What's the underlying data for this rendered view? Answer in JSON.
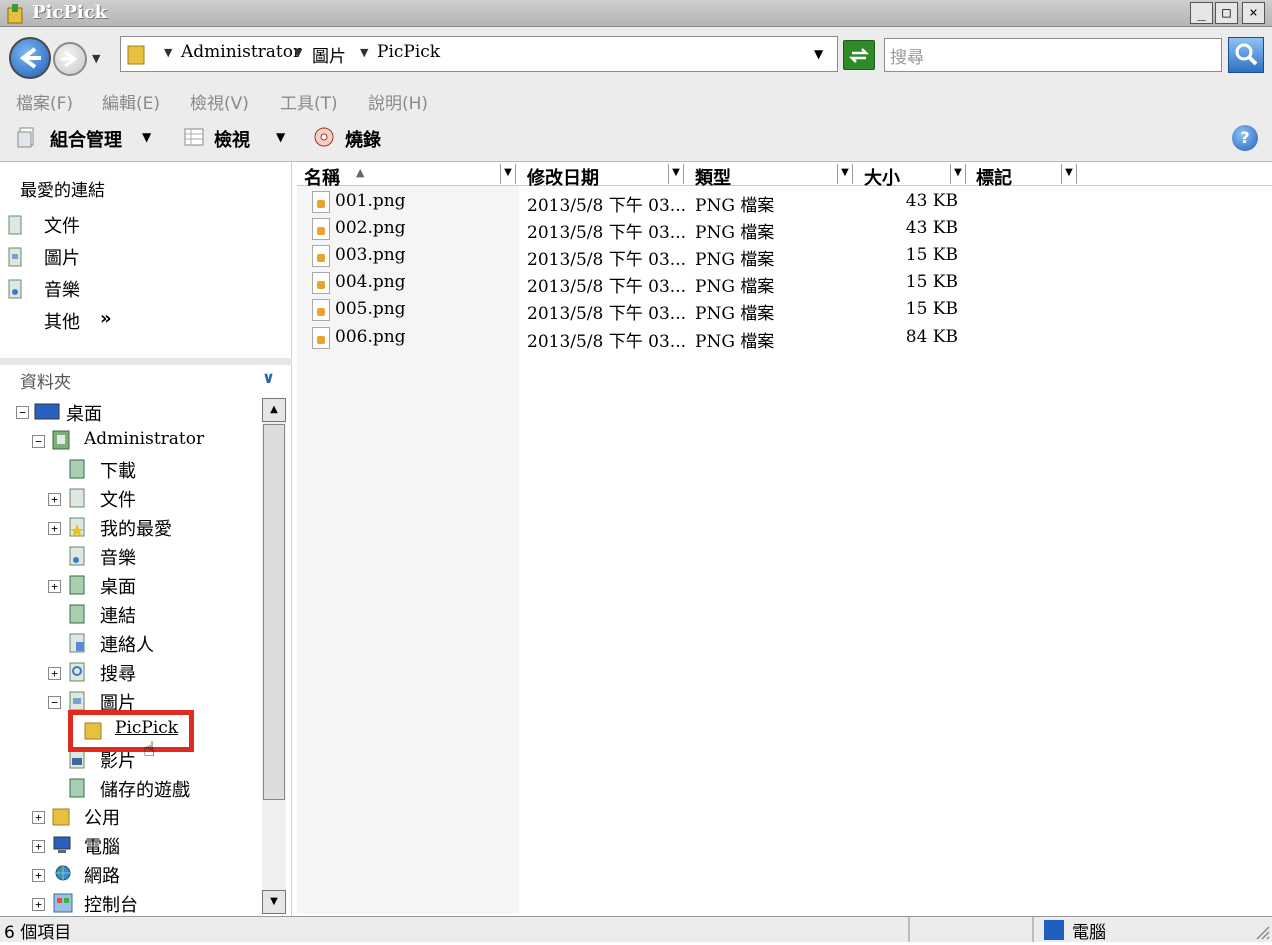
{
  "window": {
    "title": "PicPick"
  },
  "address": {
    "crumbs": [
      "Administrator",
      "圖片",
      "PicPick"
    ],
    "search_placeholder": "搜尋"
  },
  "menu": [
    "檔案(F)",
    "編輯(E)",
    "檢視(V)",
    "工具(T)",
    "說明(H)"
  ],
  "toolbar": {
    "organize": "組合管理",
    "views": "檢視",
    "burn": "燒錄"
  },
  "favorites": {
    "title": "最愛的連結",
    "items": [
      "文件",
      "圖片",
      "音樂"
    ],
    "more": "其他",
    "more_glyph": "»"
  },
  "folders": {
    "title": "資料夾",
    "tree": [
      "桌面",
      "Administrator",
      "下載",
      "文件",
      "我的最愛",
      "音樂",
      "桌面",
      "連結",
      "連絡人",
      "搜尋",
      "圖片",
      "PicPick",
      "影片",
      "儲存的遊戲",
      "公用",
      "電腦",
      "網路",
      "控制台"
    ]
  },
  "columns": [
    "名稱",
    "修改日期",
    "類型",
    "大小",
    "標記"
  ],
  "files": [
    {
      "name": "001.png",
      "date": "2013/5/8 下午 03...",
      "type": "PNG 檔案",
      "size": "43 KB"
    },
    {
      "name": "002.png",
      "date": "2013/5/8 下午 03...",
      "type": "PNG 檔案",
      "size": "43 KB"
    },
    {
      "name": "003.png",
      "date": "2013/5/8 下午 03...",
      "type": "PNG 檔案",
      "size": "15 KB"
    },
    {
      "name": "004.png",
      "date": "2013/5/8 下午 03...",
      "type": "PNG 檔案",
      "size": "15 KB"
    },
    {
      "name": "005.png",
      "date": "2013/5/8 下午 03...",
      "type": "PNG 檔案",
      "size": "15 KB"
    },
    {
      "name": "006.png",
      "date": "2013/5/8 下午 03...",
      "type": "PNG 檔案",
      "size": "84 KB"
    }
  ],
  "status": {
    "count": "6 個項目",
    "location": "電腦"
  },
  "colors": {
    "highlight": "#e02a20",
    "nav_blue": "#1f5fb8"
  }
}
